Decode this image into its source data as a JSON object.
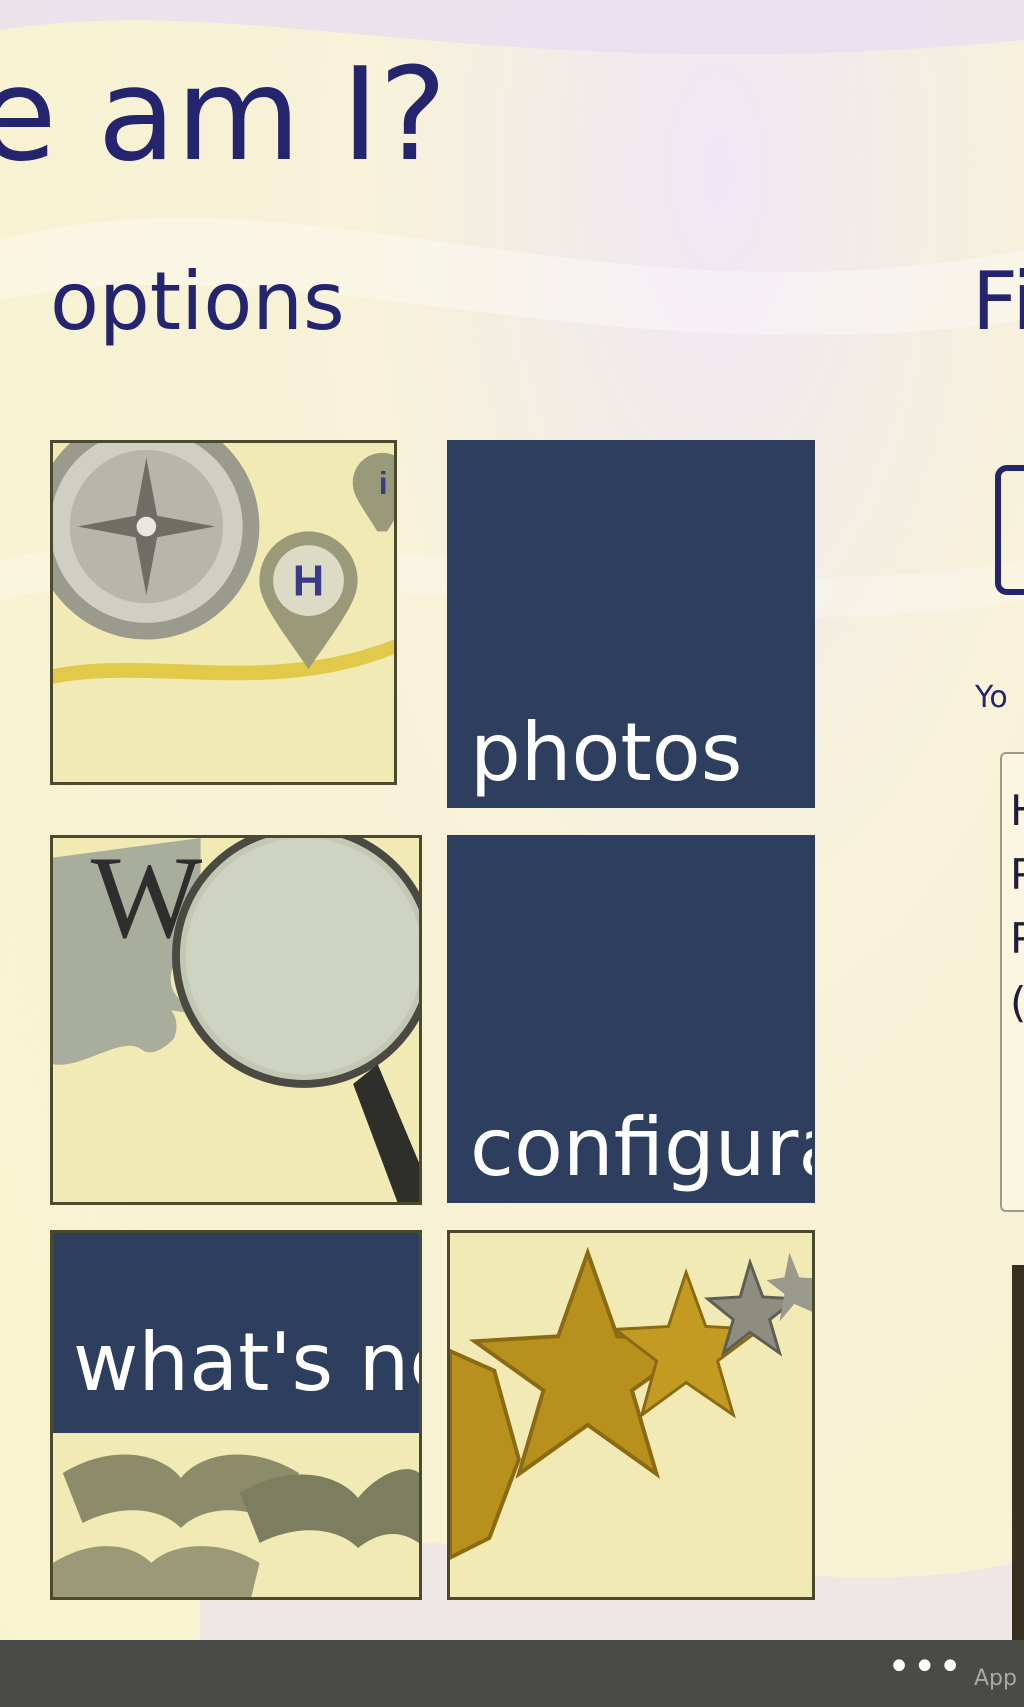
{
  "header": {
    "title": "e am I?"
  },
  "options": {
    "heading": "options"
  },
  "tiles": {
    "maps": {
      "icon": "compass-map-icon",
      "pin_letter": "H",
      "info_letter": "i"
    },
    "photos": {
      "label": "photos"
    },
    "wiki": {
      "icon": "wikipedia-magnifier-icon",
      "letter": "W"
    },
    "config": {
      "label": "configura"
    },
    "whats_new": {
      "label": "what's ne",
      "icon": "books-icon"
    },
    "rate": {
      "icon": "stars-icon"
    }
  },
  "right_panel": {
    "heading": "Fi",
    "caption": "Yo",
    "lines": [
      "H",
      "P",
      "P",
      "("
    ]
  },
  "app_bar": {
    "more": "•••",
    "label": "App"
  },
  "colors": {
    "accent": "#25256f",
    "tile_dark": "#2d3e5f",
    "app_bar": "#4a4a46"
  }
}
